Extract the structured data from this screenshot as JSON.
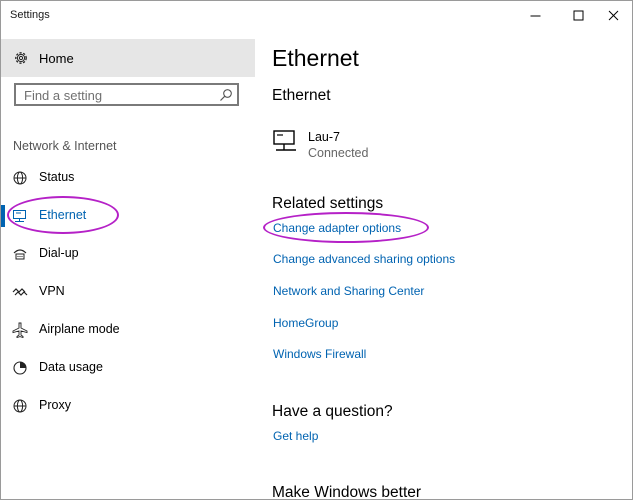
{
  "window": {
    "title": "Settings"
  },
  "sidebar": {
    "home_label": "Home",
    "search_placeholder": "Find a setting",
    "section_label": "Network & Internet",
    "items": [
      {
        "label": "Status",
        "icon": "globe-icon",
        "active": false
      },
      {
        "label": "Ethernet",
        "icon": "ethernet-icon",
        "active": true
      },
      {
        "label": "Dial-up",
        "icon": "dial-up-icon",
        "active": false
      },
      {
        "label": "VPN",
        "icon": "vpn-icon",
        "active": false
      },
      {
        "label": "Airplane mode",
        "icon": "airplane-icon",
        "active": false
      },
      {
        "label": "Data usage",
        "icon": "data-usage-icon",
        "active": false
      },
      {
        "label": "Proxy",
        "icon": "globe-icon",
        "active": false
      }
    ]
  },
  "main": {
    "page_title": "Ethernet",
    "section_title": "Ethernet",
    "connection": {
      "name": "Lau-7",
      "status": "Connected"
    },
    "related_title": "Related settings",
    "related_links": [
      "Change adapter options",
      "Change advanced sharing options",
      "Network and Sharing Center",
      "HomeGroup",
      "Windows Firewall"
    ],
    "question_title": "Have a question?",
    "help_link": "Get help",
    "better_title": "Make Windows better"
  },
  "colors": {
    "accent": "#0063b1",
    "highlight_ellipse": "#b521c7",
    "sidebar_selected_bg": "#e6e6e6"
  }
}
